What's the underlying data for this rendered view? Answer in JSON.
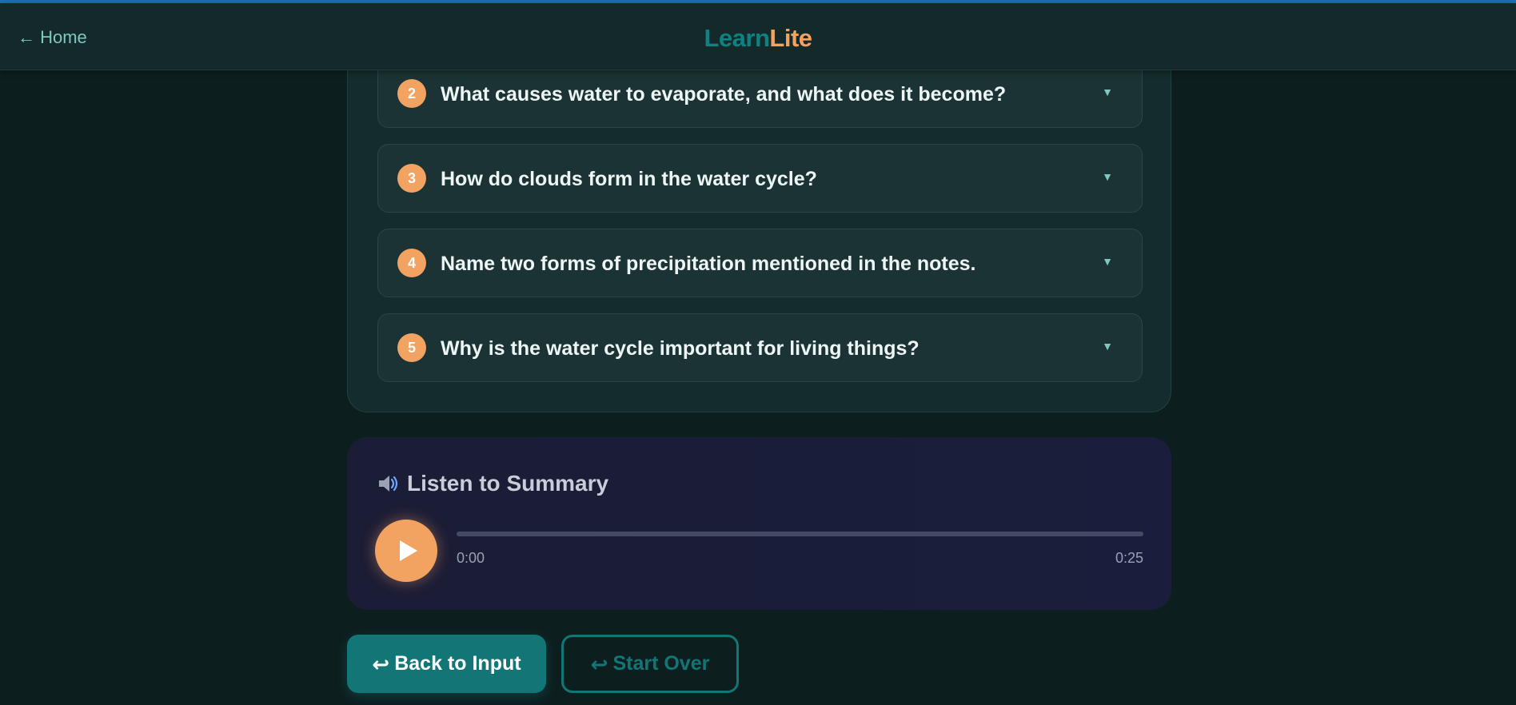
{
  "header": {
    "home_label": "← Home",
    "logo_part1": "Learn",
    "logo_part2": "Lite"
  },
  "questions": [
    {
      "number": "2",
      "text": "What causes water to evaporate, and what does it become?"
    },
    {
      "number": "3",
      "text": "How do clouds form in the water cycle?"
    },
    {
      "number": "4",
      "text": "Name two forms of precipitation mentioned in the notes."
    },
    {
      "number": "5",
      "text": "Why is the water cycle important for living things?"
    }
  ],
  "audio": {
    "icon": "speaker-icon",
    "title": "Listen to Summary",
    "current_time": "0:00",
    "duration": "0:25",
    "progress": 0
  },
  "actions": {
    "back_label": "Back to Input",
    "start_over_label": "Start Over",
    "icon_glyph": "↩"
  },
  "colors": {
    "accent": "#f2a261",
    "primary": "#137676",
    "background": "#0d1e1f"
  }
}
